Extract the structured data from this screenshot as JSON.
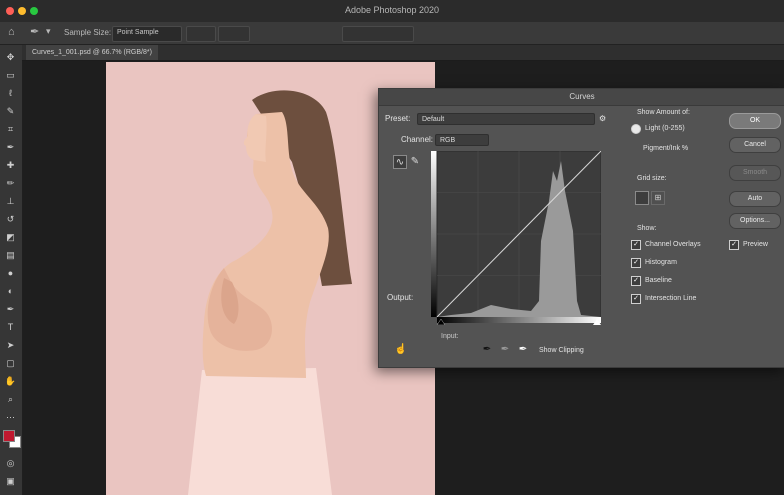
{
  "app": {
    "title": "Adobe Photoshop 2020",
    "traffic_colors": [
      "#ff5f57",
      "#febc2e",
      "#28c840"
    ]
  },
  "options_bar": {
    "sample_size_label": "Sample Size:",
    "sample_size_value": "Point Sample"
  },
  "document": {
    "tab_label": "Curves_1_001.psd @ 66.7% (RGB/8*)"
  },
  "tools": [
    "move-icon",
    "marquee-icon",
    "lasso-icon",
    "quick-select-icon",
    "crop-icon",
    "eyedropper-icon",
    "healing-icon",
    "brush-icon",
    "stamp-icon",
    "history-brush-icon",
    "eraser-icon",
    "gradient-icon",
    "blur-icon",
    "dodge-icon",
    "pen-icon",
    "type-icon",
    "path-select-icon",
    "shape-icon",
    "hand-icon",
    "zoom-icon"
  ],
  "colors": {
    "foreground": "#c0192f",
    "background": "#ffffff",
    "photo_bg": "#eac5c1"
  },
  "curves": {
    "title": "Curves",
    "preset_label": "Preset:",
    "preset_value": "Default",
    "channel_label": "Channel:",
    "channel_value": "RGB",
    "output_label": "Output:",
    "input_label": "Input:",
    "show_clipping_label": "Show Clipping",
    "show_amount_label": "Show Amount of:",
    "light_option": "Light (0-255)",
    "pigment_option": "Pigment/Ink %",
    "grid_size_label": "Grid size:",
    "show_label": "Show:",
    "show_options": [
      {
        "label": "Channel Overlays",
        "checked": true
      },
      {
        "label": "Histogram",
        "checked": true
      },
      {
        "label": "Baseline",
        "checked": true
      },
      {
        "label": "Intersection Line",
        "checked": true
      }
    ],
    "buttons": {
      "ok": "OK",
      "cancel": "Cancel",
      "smooth": "Smooth",
      "auto": "Auto",
      "options": "Options..."
    },
    "preview_label": "Preview",
    "preview_checked": true
  }
}
